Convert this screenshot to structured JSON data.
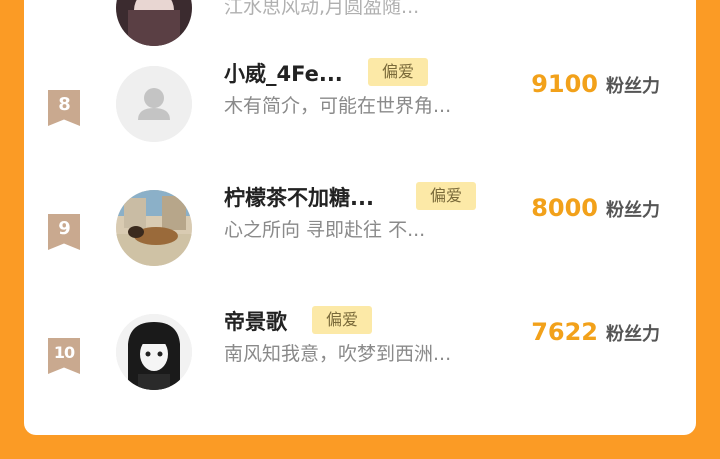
{
  "rows": [
    {
      "rank": "",
      "name": "",
      "badge": "",
      "bio": "江水思风动,月圆盈随...",
      "fans_value": "",
      "fans_unit": "",
      "avatar": "photo-avatar"
    },
    {
      "rank": "8",
      "name": "小威_4Fe...",
      "badge": "偏爱",
      "bio": "木有简介，可能在世界角...",
      "fans_value": "9100",
      "fans_unit": "粉丝力",
      "avatar": "default-user-icon"
    },
    {
      "rank": "9",
      "name": "柠檬茶不加糖...",
      "badge": "偏爱",
      "bio": "心之所向 寻即赴往 不...",
      "fans_value": "8000",
      "fans_unit": "粉丝力",
      "avatar": "dog-photo-avatar"
    },
    {
      "rank": "10",
      "name": "帝景歌",
      "badge": "偏爱",
      "bio": "南风知我意，吹梦到西洲...",
      "fans_value": "7622",
      "fans_unit": "粉丝力",
      "avatar": "anime-girl-avatar"
    }
  ],
  "colors": {
    "background": "#FB9B25",
    "rank_badge": "#C9A98F",
    "fan_value": "#F2A11A",
    "tag_bg": "#FCE9A7"
  }
}
